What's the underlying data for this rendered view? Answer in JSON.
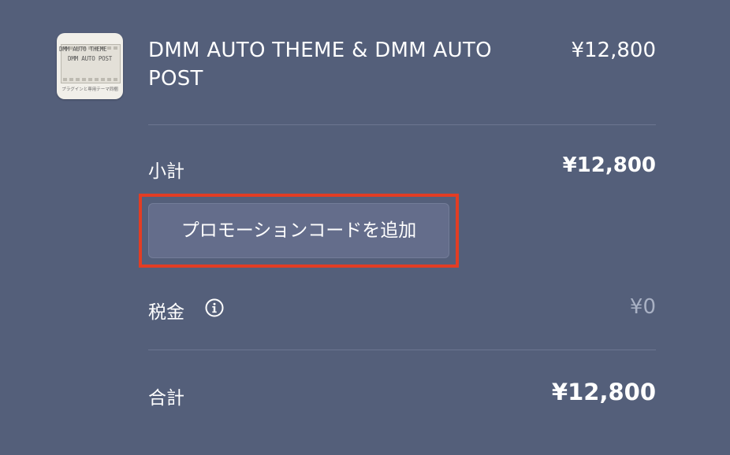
{
  "product": {
    "thumbnail": {
      "line1": "DMM AUTO THEME",
      "line2": "DMM AUTO POST",
      "caption": "プラグインと専用テーマ同梱"
    },
    "name": "DMM AUTO THEME & DMM AUTO POST",
    "price": "¥12,800"
  },
  "summary": {
    "subtotal_label": "小計",
    "subtotal_value": "¥12,800",
    "promo_button_label": "プロモーションコードを追加",
    "tax_label": "税金",
    "tax_info_icon": "info-circle-icon",
    "tax_value": "¥0",
    "total_label": "合計",
    "total_value": "¥12,800"
  },
  "colors": {
    "background": "#545f7a",
    "highlight": "#e23d24",
    "button": "#646d8b"
  }
}
